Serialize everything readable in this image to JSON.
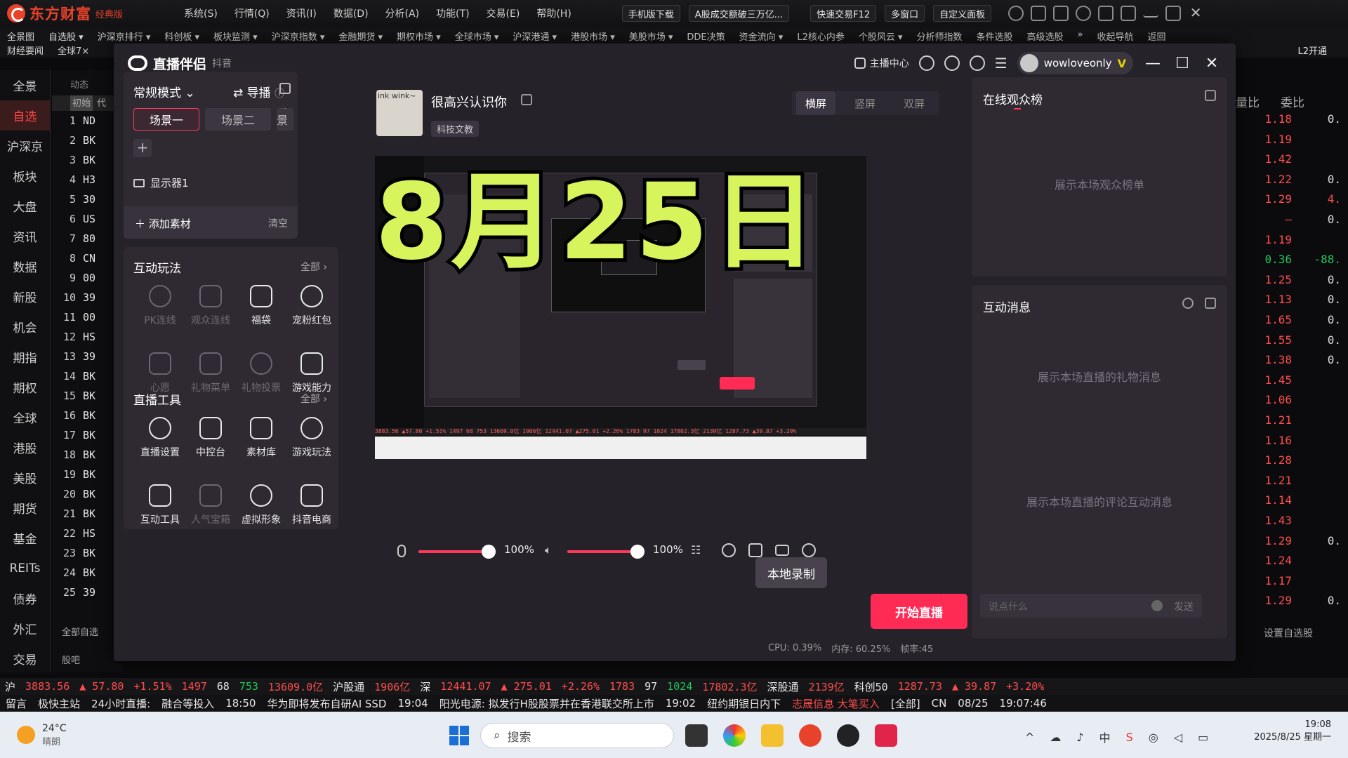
{
  "app": {
    "brand": "东方财富",
    "edition": "经典版"
  },
  "top_menu": [
    "系统(S)",
    "行情(Q)",
    "资讯(I)",
    "数据(D)",
    "分析(A)",
    "功能(T)",
    "交易(E)",
    "帮助(H)"
  ],
  "top_buttons": {
    "mobile": "手机版下载",
    "news": "A股成交额破三万亿...",
    "quick_trade": "快速交易F12",
    "multi": "多窗口",
    "custom": "自定义面板"
  },
  "menu_row1": [
    "全景图",
    "自选股 ▾",
    "沪深京排行 ▾",
    "科创板 ▾",
    "板块监测 ▾",
    "沪深京指数 ▾",
    "金融期货 ▾",
    "期权市场 ▾",
    "全球市场 ▾",
    "沪深港通 ▾",
    "港股市场 ▾",
    "美股市场 ▾",
    "DDE决策",
    "资金流向 ▾",
    "L2核心内参",
    "个股风云 ▾",
    "分析师指数",
    "条件选股",
    "高级选股",
    "»",
    "收起导航",
    "返回"
  ],
  "menu_row2": [
    "财经要闻",
    "全球7×"
  ],
  "l2_label": "L2开通",
  "leftnav": [
    "全景",
    "自选",
    "沪深京",
    "板块",
    "大盘",
    "资讯",
    "数据",
    "新股",
    "机会",
    "期指",
    "期权",
    "全球",
    "港股",
    "美股",
    "期货",
    "基金",
    "REITs",
    "债券",
    "外汇",
    "交易"
  ],
  "stocklist": {
    "header": [
      "初始",
      "代"
    ],
    "tab": "动态",
    "rows": [
      [
        "1",
        "ND"
      ],
      [
        "2",
        "BK"
      ],
      [
        "3",
        "BK"
      ],
      [
        "4",
        "H3"
      ],
      [
        "5",
        "30"
      ],
      [
        "6",
        "US"
      ],
      [
        "7",
        "80"
      ],
      [
        "8",
        "CN"
      ],
      [
        "9",
        "00"
      ],
      [
        "10",
        "39"
      ],
      [
        "11",
        "00"
      ],
      [
        "12",
        "HS"
      ],
      [
        "13",
        "39"
      ],
      [
        "14",
        "BK"
      ],
      [
        "15",
        "BK"
      ],
      [
        "16",
        "BK"
      ],
      [
        "17",
        "BK"
      ],
      [
        "18",
        "BK"
      ],
      [
        "19",
        "BK"
      ],
      [
        "20",
        "BK"
      ],
      [
        "21",
        "BK"
      ],
      [
        "22",
        "HS"
      ],
      [
        "23",
        "BK"
      ],
      [
        "24",
        "BK"
      ],
      [
        "25",
        "39"
      ]
    ],
    "footer": [
      "全部自选",
      "股吧"
    ]
  },
  "rightcols": {
    "headers": [
      "量比",
      "委比"
    ],
    "rows": [
      [
        "1.18",
        "0."
      ],
      [
        "1.19",
        ""
      ],
      [
        "1.42",
        ""
      ],
      [
        "1.22",
        "0."
      ],
      [
        "1.29",
        "4."
      ],
      [
        "—",
        "0."
      ],
      [
        "1.19",
        ""
      ],
      [
        "0.36",
        "-88."
      ],
      [
        "1.25",
        "0."
      ],
      [
        "1.13",
        "0."
      ],
      [
        "1.65",
        "0."
      ],
      [
        "1.55",
        "0."
      ],
      [
        "1.38",
        "0."
      ],
      [
        "1.45",
        ""
      ],
      [
        "1.06",
        ""
      ],
      [
        "1.21",
        ""
      ],
      [
        "1.16",
        ""
      ],
      [
        "1.28",
        ""
      ],
      [
        "1.21",
        ""
      ],
      [
        "1.14",
        ""
      ],
      [
        "1.43",
        ""
      ],
      [
        "1.29",
        "0."
      ],
      [
        "1.24",
        ""
      ],
      [
        "1.17",
        ""
      ],
      [
        "1.29",
        "0."
      ]
    ],
    "footer": "设置自选股"
  },
  "live": {
    "title": "直播伴侣",
    "platform": "抖音",
    "host_center": "主播中心",
    "username": "wowloveonly",
    "mode": "常规模式",
    "guide": "导播",
    "scenes": [
      "场景一",
      "场景二",
      "场景三"
    ],
    "display": "显示器1",
    "add_source": "添加素材",
    "clear": "清空",
    "interact_title": "互动玩法",
    "all": "全部",
    "interact_items": [
      {
        "label": "PK连线",
        "dim": true
      },
      {
        "label": "观众连线",
        "dim": true
      },
      {
        "label": "福袋",
        "dim": false
      },
      {
        "label": "宠粉红包",
        "dim": false
      },
      {
        "label": "心愿",
        "dim": true
      },
      {
        "label": "礼物菜单",
        "dim": true
      },
      {
        "label": "礼物投票",
        "dim": true
      },
      {
        "label": "游戏能力",
        "dim": false
      }
    ],
    "tools_title": "直播工具",
    "tool_items": [
      {
        "label": "直播设置",
        "dim": false
      },
      {
        "label": "中控台",
        "dim": false
      },
      {
        "label": "素材库",
        "dim": false
      },
      {
        "label": "游戏玩法",
        "dim": false
      },
      {
        "label": "互动工具",
        "dim": false
      },
      {
        "label": "人气宝箱",
        "dim": true
      },
      {
        "label": "虚拟形象",
        "dim": false
      },
      {
        "label": "抖音电商",
        "dim": false
      }
    ],
    "stream_name": "很高兴认识你",
    "stream_tag": "科技文教",
    "avatar_text": "ink wink~",
    "orient_tabs": [
      "横屏",
      "竖屏",
      "双屏"
    ],
    "overlay_date": "8月25日",
    "mic_volume": "100%",
    "speaker_volume": "100%",
    "tooltip": "本地录制",
    "start_button": "开始直播",
    "stats": {
      "cpu": "CPU: 0.39%",
      "mem": "内存: 60.25%",
      "fps": "帧率:45"
    },
    "audience_title": "在线观众榜",
    "audience_placeholder": "展示本场观众榜单",
    "messages_title": "互动消息",
    "gift_placeholder": "展示本场直播的礼物消息",
    "comment_placeholder": "展示本场直播的评论互动消息",
    "chat_placeholder": "说点什么",
    "send": "发送"
  },
  "index_bar": [
    "沪",
    "3883.56",
    "▲ 57.80",
    "+1.51%",
    "1497",
    "68",
    "753",
    "13609.0亿",
    "沪股通",
    "1906亿",
    "深",
    "12441.07",
    "▲ 275.01",
    "+2.26%",
    "1783",
    "97",
    "1024",
    "17802.3亿",
    "深股通",
    "2139亿",
    "科创50",
    "1287.73",
    "▲ 39.87",
    "+3.20%"
  ],
  "news_bar": [
    "留言",
    "极快主站",
    "24小时直播:",
    "融合等投入",
    "18:50",
    "华为即将发布自研AI SSD",
    "19:04",
    "阳光电源: 拟发行H股股票并在香港联交所上市",
    "19:02",
    "纽约期银日内下",
    "志晟信息 大笔买入",
    "[全部]",
    "CN",
    "08/25",
    "19:07:46"
  ],
  "taskbar": {
    "temp": "24°C",
    "weather": "晴朗",
    "search": "搜索",
    "time": "19:08",
    "date": "2025/8/25 星期一"
  },
  "colors": {
    "accent": "#ff2b55",
    "up": "#ff4d4d",
    "overlay": "#d7f45c"
  }
}
